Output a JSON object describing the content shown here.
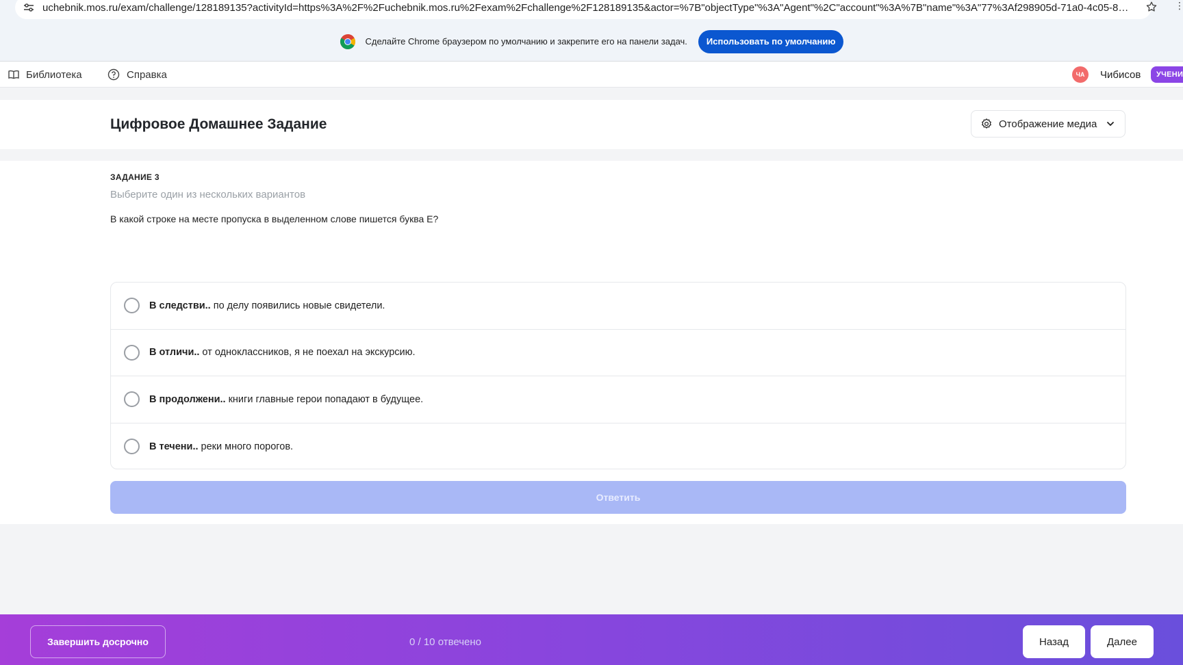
{
  "browser": {
    "url": "uchebnik.mos.ru/exam/challenge/128189135?activityId=https%3A%2F%2Fuchebnik.mos.ru%2Fexam%2Fchallenge%2F128189135&actor=%7B\"objectType\"%3A\"Agent\"%2C\"account\"%3A%7B\"name\"%3A\"77%3Af298905d-71a0-4c05-8dab-6b9b5ea523fa\"%7..."
  },
  "promo": {
    "text": "Сделайте Chrome браузером по умолчанию и закрепите его на панели задач.",
    "button": "Использовать по умолчанию"
  },
  "topnav": {
    "library": "Библиотека",
    "help": "Справка",
    "avatar_initials": "ЧА",
    "user_name": "Чибисов",
    "role_badge": "УЧЕНИ"
  },
  "header": {
    "title": "Цифровое Домашнее Задание",
    "media_button": "Отображение медиа"
  },
  "task": {
    "label": "ЗАДАНИЕ 3",
    "hint": "Выберите один из нескольких вариантов",
    "question": "В какой строке на месте пропуска в выделенном слове пишется буква Е?",
    "options": [
      {
        "bold": "В следстви..",
        "rest": "по делу появились новые свидетели."
      },
      {
        "bold": "В отличи..",
        "rest": "от одноклассников, я не поехал на экскурсию."
      },
      {
        "bold": "В продолжени..",
        "rest": "книги главные герои попадают в будущее."
      },
      {
        "bold": "В течени..",
        "rest": "реки много порогов."
      }
    ],
    "answer_button": "Ответить"
  },
  "footer": {
    "finish_button": "Завершить досрочно",
    "progress": "0 / 10 отвечено",
    "back_button": "Назад",
    "next_button": "Далее"
  },
  "colors": {
    "accent": "#0b57d0",
    "answer_disabled": "#a9b8f6",
    "footer_gradient_start": "#a53ed9",
    "footer_gradient_end": "#6a4fdc"
  }
}
